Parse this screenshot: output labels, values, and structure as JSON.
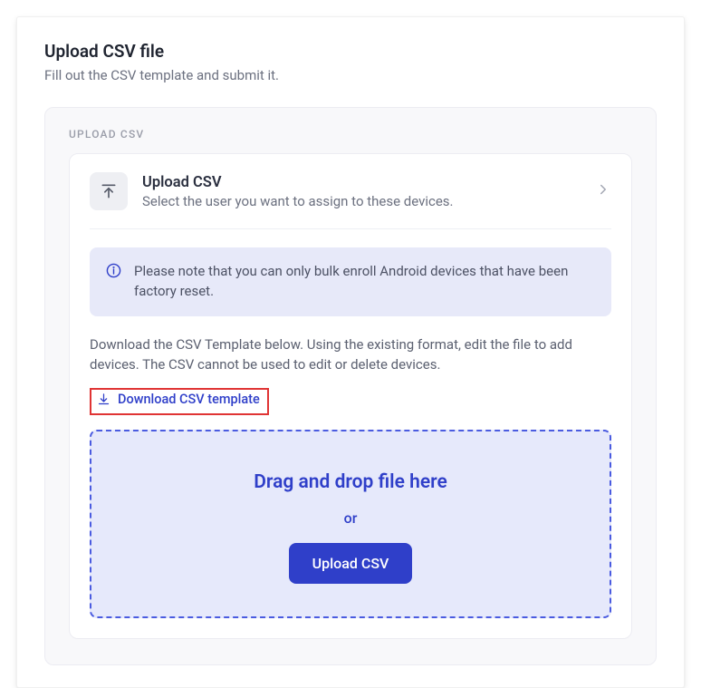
{
  "header": {
    "title": "Upload CSV file",
    "subtitle": "Fill out the CSV template and submit it."
  },
  "section": {
    "label": "UPLOAD CSV",
    "step": {
      "title": "Upload CSV",
      "description": "Select the user you want to assign to these devices."
    },
    "note": "Please note that you can only bulk enroll Android devices that have been factory reset.",
    "instruction": "Download the CSV Template below. Using the existing format, edit the file to add devices. The CSV cannot be used to edit or delete devices.",
    "download_label": "Download CSV template",
    "dropzone": {
      "title": "Drag and drop file here",
      "or": "or",
      "button": "Upload CSV"
    }
  }
}
